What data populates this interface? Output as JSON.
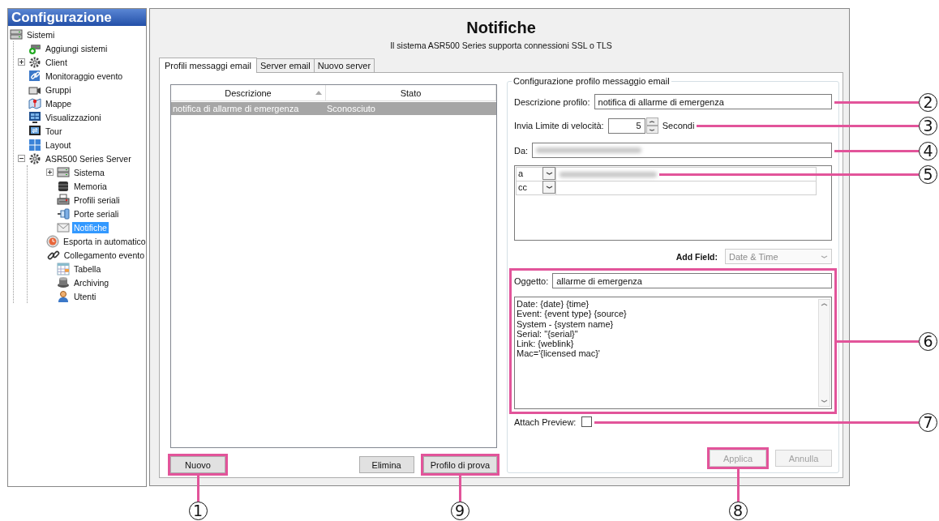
{
  "sidebar": {
    "title": "Configurazione",
    "tree": [
      {
        "label": "Sistemi",
        "selected": false,
        "children": [
          {
            "label": "Aggiungi sistemi",
            "selected": false
          },
          {
            "label": "Client",
            "selected": false,
            "expanded": false
          },
          {
            "label": "Monitoraggio evento",
            "selected": false
          },
          {
            "label": "Gruppi",
            "selected": false
          },
          {
            "label": "Mappe",
            "selected": false
          },
          {
            "label": "Visualizzazioni",
            "selected": false
          },
          {
            "label": "Tour",
            "selected": false
          },
          {
            "label": "Layout",
            "selected": false
          },
          {
            "label": "ASR500 Series Server",
            "selected": false,
            "expanded": true,
            "children": [
              {
                "label": "Sistema",
                "selected": false,
                "expanded": false
              },
              {
                "label": "Memoria",
                "selected": false
              },
              {
                "label": "Profili seriali",
                "selected": false
              },
              {
                "label": "Porte seriali",
                "selected": false
              },
              {
                "label": "Notifiche",
                "selected": true
              },
              {
                "label": "Esporta in automatico",
                "selected": false
              },
              {
                "label": "Collegamento evento",
                "selected": false
              },
              {
                "label": "Tabella",
                "selected": false
              },
              {
                "label": "Archiving",
                "selected": false
              },
              {
                "label": "Utenti",
                "selected": false
              }
            ]
          }
        ]
      }
    ]
  },
  "page": {
    "title": "Notifiche",
    "subtitle": "Il sistema ASR500 Series supporta connessioni SSL o TLS"
  },
  "tabs": [
    {
      "label": "Profili messaggi email",
      "selected": true
    },
    {
      "label": "Server email",
      "selected": false
    },
    {
      "label": "Nuovo server",
      "selected": false
    }
  ],
  "profile_list": {
    "columns": [
      {
        "label": "Descrizione",
        "sorted": true
      },
      {
        "label": "Stato",
        "sorted": false
      }
    ],
    "rows": [
      {
        "cells": [
          "notifica di allarme di emergenza",
          "Sconosciuto"
        ],
        "selected": true
      }
    ],
    "buttons": [
      {
        "label": "Nuovo",
        "callout": "1"
      },
      {
        "label": "Elimina"
      },
      {
        "label": "Profilo di prova",
        "callout": "9"
      }
    ]
  },
  "profile_form": {
    "legend": "Configurazione profilo messaggio email",
    "description": {
      "label": "Descrizione profilo:",
      "value": "notifica di allarme di emergenza",
      "callout": "2"
    },
    "rate_limit": {
      "label": "Invia Limite di velocità:",
      "value": "5",
      "unit": "Secondi",
      "callout": "3"
    },
    "from": {
      "label": "Da:",
      "value_hidden": true,
      "callout": "4"
    },
    "recipients": [
      {
        "type": "a",
        "address_hidden": true,
        "callout": "5"
      },
      {
        "type": "cc",
        "address_hidden": false
      }
    ],
    "add_field": {
      "label": "Add Field:",
      "value": "Date & Time",
      "disabled": true
    },
    "message": {
      "callout": "6",
      "subject_label": "Oggetto:",
      "subject": "allarme di emergenza",
      "body": [
        "Date: {date} {time}",
        "Event: {event type} {source}",
        "System - {system name}",
        "Serial: \"{serial}\"",
        "Link: {weblink}",
        "Mac='{licensed mac}'"
      ]
    },
    "attach_preview": {
      "label": "Attach Preview:",
      "checked": false,
      "callout": "7"
    },
    "buttons": [
      {
        "label": "Applica",
        "disabled": true,
        "callout": "8"
      },
      {
        "label": "Annulla",
        "disabled": true
      }
    ]
  }
}
